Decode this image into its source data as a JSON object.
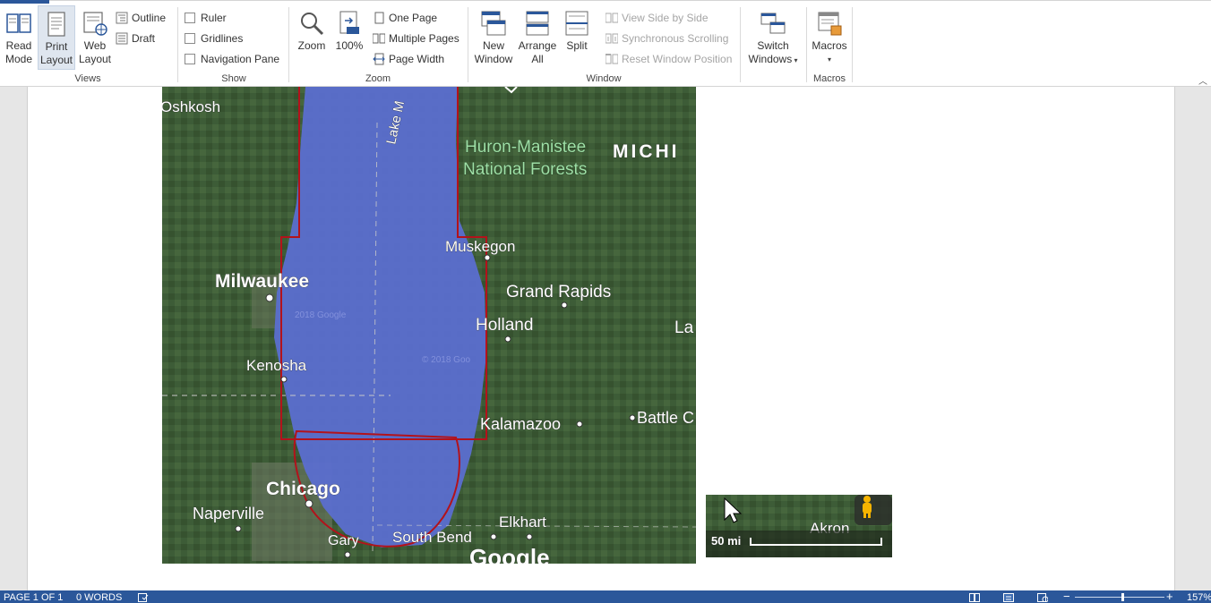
{
  "ribbon": {
    "groups": {
      "views": "Views",
      "show": "Show",
      "zoom": "Zoom",
      "window": "Window",
      "macros": "Macros"
    },
    "views": {
      "read_mode": [
        "Read",
        "Mode"
      ],
      "print_layout": [
        "Print",
        "Layout"
      ],
      "web_layout": [
        "Web",
        "Layout"
      ],
      "outline": "Outline",
      "draft": "Draft"
    },
    "show": {
      "ruler": "Ruler",
      "gridlines": "Gridlines",
      "navigation_pane": "Navigation Pane"
    },
    "zoom": {
      "zoom": "Zoom",
      "hundred": "100%",
      "one_page": "One Page",
      "multiple_pages": "Multiple Pages",
      "page_width": "Page Width"
    },
    "window": {
      "new_window": [
        "New",
        "Window"
      ],
      "arrange_all": [
        "Arrange",
        "All"
      ],
      "split": "Split",
      "view_side_by_side": "View Side by Side",
      "synchronous_scrolling": "Synchronous Scrolling",
      "reset_window_position": "Reset Window Position",
      "switch_windows": [
        "Switch",
        "Windows"
      ]
    },
    "macros": {
      "macros": "Macros"
    }
  },
  "map": {
    "labels": {
      "oshkosh": "Oshkosh",
      "lake_michigan": "Lake M",
      "huron_1": "Huron-Manistee",
      "huron_2": "National Forests",
      "michigan": "MICHI",
      "muskegon": "Muskegon",
      "milwaukee": "Milwaukee",
      "grand_rapids": "Grand Rapids",
      "holland": "Holland",
      "lansing": "La",
      "kenosha": "Kenosha",
      "kalamazoo": "Kalamazoo",
      "battle_creek": "Battle C",
      "chicago": "Chicago",
      "naperville": "Naperville",
      "elkhart": "Elkhart",
      "gary": "Gary",
      "south_bend": "South Bend",
      "google": "Google",
      "watermark_1": "2018 Google",
      "watermark_2": "© 2018 Goo"
    },
    "thumb": {
      "akron": "Akron",
      "scale": "50 mi"
    }
  },
  "status": {
    "page": "PAGE 1 OF 1",
    "words": "0 WORDS",
    "zoom": "157%"
  },
  "colors": {
    "accent": "#2b579a",
    "lake_overlay": "#5b6ecf",
    "outline_red": "#b3121b"
  }
}
